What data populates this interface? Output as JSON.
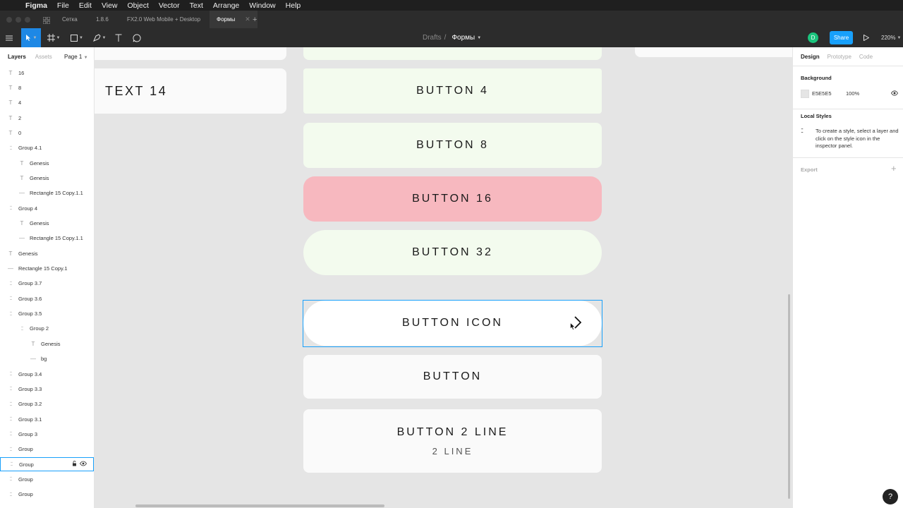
{
  "menubar": {
    "app": "Figma",
    "items": [
      "File",
      "Edit",
      "View",
      "Object",
      "Vector",
      "Text",
      "Arrange",
      "Window",
      "Help"
    ]
  },
  "tabs": [
    {
      "label": "Сетка"
    },
    {
      "label": "1.8.6"
    },
    {
      "label": "FX2.0 Web Mobile + Desktop"
    },
    {
      "label": "Формы"
    }
  ],
  "toolbar": {
    "breadcrumb_parent": "Drafts",
    "breadcrumb_sep": "/",
    "breadcrumb_current": "Формы",
    "avatar_initial": "D",
    "share_label": "Share",
    "zoom": "220%"
  },
  "layers_panel": {
    "tab_layers": "Layers",
    "tab_assets": "Assets",
    "page": "Page 1",
    "rows": [
      {
        "label": "16",
        "icon": "text-icon",
        "indent": 0
      },
      {
        "label": "8",
        "icon": "text-icon",
        "indent": 0
      },
      {
        "label": "4",
        "icon": "text-icon",
        "indent": 0
      },
      {
        "label": "2",
        "icon": "text-icon",
        "indent": 0
      },
      {
        "label": "0",
        "icon": "text-icon",
        "indent": 0
      },
      {
        "label": "Group 4.1",
        "icon": "group-icon",
        "indent": 0
      },
      {
        "label": "Genesis",
        "icon": "text-icon",
        "indent": 1
      },
      {
        "label": "Genesis",
        "icon": "text-icon",
        "indent": 1
      },
      {
        "label": "Rectangle 15 Copy.1.1",
        "icon": "rectangle-icon",
        "indent": 1
      },
      {
        "label": "Group 4",
        "icon": "group-icon",
        "indent": 0
      },
      {
        "label": "Genesis",
        "icon": "text-icon",
        "indent": 1
      },
      {
        "label": "Rectangle 15 Copy.1.1",
        "icon": "rectangle-icon",
        "indent": 1
      },
      {
        "label": "Genesis",
        "icon": "text-icon",
        "indent": 0
      },
      {
        "label": "Rectangle 15 Copy.1",
        "icon": "rectangle-icon",
        "indent": 0
      },
      {
        "label": "Group 3.7",
        "icon": "group-icon",
        "indent": 0
      },
      {
        "label": "Group 3.6",
        "icon": "group-icon",
        "indent": 0
      },
      {
        "label": "Group 3.5",
        "icon": "group-icon",
        "indent": 0
      },
      {
        "label": "Group 2",
        "icon": "group-icon",
        "indent": 1
      },
      {
        "label": "Genesis",
        "icon": "text-icon",
        "indent": 2
      },
      {
        "label": "bg",
        "icon": "rectangle-icon",
        "indent": 2
      },
      {
        "label": "Group 3.4",
        "icon": "group-icon",
        "indent": 0
      },
      {
        "label": "Group 3.3",
        "icon": "group-icon",
        "indent": 0
      },
      {
        "label": "Group 3.2",
        "icon": "group-icon",
        "indent": 0
      },
      {
        "label": "Group 3.1",
        "icon": "group-icon",
        "indent": 0
      },
      {
        "label": "Group 3",
        "icon": "group-icon",
        "indent": 0
      },
      {
        "label": "Group",
        "icon": "group-icon",
        "indent": 0
      },
      {
        "label": "Group",
        "icon": "group-icon",
        "indent": 0,
        "selected": true
      },
      {
        "label": "Group",
        "icon": "group-icon",
        "indent": 0
      },
      {
        "label": "Group",
        "icon": "group-icon",
        "indent": 0
      }
    ]
  },
  "canvas": {
    "text_card": "TEXT 14",
    "buttons": [
      {
        "label": "BUTTON 4",
        "color": "#f3fbee"
      },
      {
        "label": "BUTTON 8",
        "color": "#f3fbee"
      },
      {
        "label": "BUTTON 16",
        "color": "#f7b8bf"
      },
      {
        "label": "BUTTON 32",
        "color": "#f3fbee"
      },
      {
        "label": "BUTTON ICON",
        "color": "#ffffff",
        "selected": true
      },
      {
        "label": "BUTTON",
        "color": "#fafafa"
      },
      {
        "label": "BUTTON 2 LINE",
        "sublabel": "2 LINE",
        "color": "#fafafa"
      }
    ]
  },
  "properties_panel": {
    "tab_design": "Design",
    "tab_prototype": "Prototype",
    "tab_code": "Code",
    "background_title": "Background",
    "background_hex": "E5E5E5",
    "background_opacity": "100%",
    "local_styles_title": "Local Styles",
    "local_styles_text": "To create a style, select a layer and click on the style icon in the inspector panel.",
    "export_title": "Export"
  },
  "help": "?",
  "colors": {
    "accent": "#18a0fb",
    "canvas": "#e5e5e5",
    "dark_ui": "#2c2c2c"
  }
}
